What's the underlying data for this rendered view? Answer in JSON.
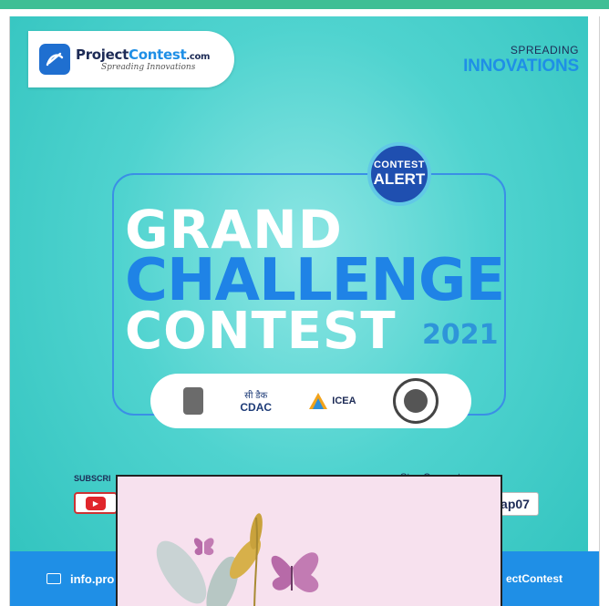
{
  "banner": {
    "logo": {
      "name_dark": "Project",
      "name_accent": "Contest",
      "name_suffix": ".com",
      "tagline": "Spreading Innovations"
    },
    "slogan": {
      "top": "SPREADING",
      "bottom": "INNOVATIONS"
    },
    "badge": {
      "line1": "CONTEST",
      "line2": "ALERT"
    },
    "headline": {
      "line1": "GRAND",
      "line2": "CHALLENGE",
      "line3": "CONTEST",
      "year": "2021"
    },
    "partners": {
      "cdac_hindi": "सी डैक",
      "cdac": "CDAC",
      "icea": "ICEA"
    },
    "subscribe": "SUBSCRI",
    "connect": "Stay Connect",
    "handle": "ap07",
    "footer": {
      "email": "info.pro",
      "right": "ectContest"
    }
  },
  "colors": {
    "teal": "#2fc2bd",
    "blue": "#1f8fe6",
    "navy": "#1d2b56",
    "overlay": "#f7e1ee"
  },
  "icons": [
    "logo-icon",
    "youtube-icon",
    "mail-icon",
    "emblem-icon",
    "icea-icon",
    "seal-icon",
    "butterfly-icon",
    "leaf-icon"
  ]
}
